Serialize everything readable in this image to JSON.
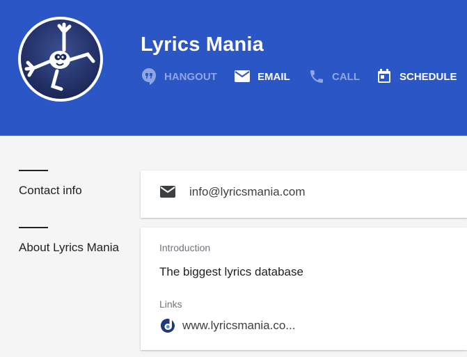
{
  "profile": {
    "name": "Lyrics Mania",
    "actions": [
      {
        "label": "HANGOUT",
        "icon": "hangout-icon",
        "enabled": false
      },
      {
        "label": "EMAIL",
        "icon": "email-icon",
        "enabled": true
      },
      {
        "label": "CALL",
        "icon": "phone-icon",
        "enabled": false
      },
      {
        "label": "SCHEDULE",
        "icon": "calendar-icon",
        "enabled": true
      }
    ]
  },
  "contact": {
    "title": "Contact info",
    "email": "info@lyricsmania.com"
  },
  "about": {
    "title": "About Lyrics Mania",
    "intro_label": "Introduction",
    "intro_text": "The biggest lyrics database",
    "links_label": "Links",
    "link_text": "www.lyricsmania.co..."
  },
  "colors": {
    "header": "#2a56c6",
    "background": "#f5f5f5",
    "card": "#ffffff",
    "action_dim": "#8fa6e0",
    "action_bright": "#ffffff"
  }
}
